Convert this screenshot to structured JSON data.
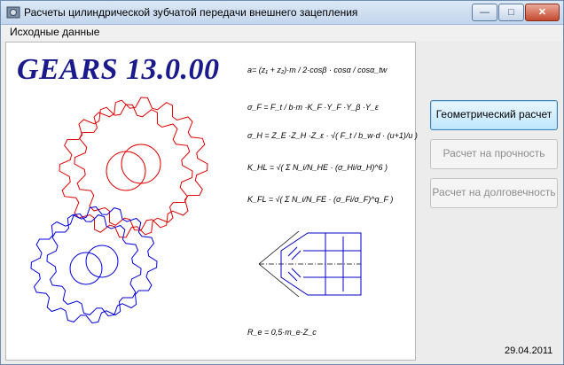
{
  "window": {
    "title": "Расчеты цилиндрической зубчатой передачи внешнего зацепления",
    "controls": {
      "minimize": "—",
      "maximize": "□",
      "close": "✕"
    }
  },
  "menu": {
    "items": [
      "Исходные данные"
    ]
  },
  "panel": {
    "logo": "GEARS 13.0.00",
    "formulas": {
      "aw_lhs": "a",
      "aw_eq": "= (z₁ + z₂)·m / 2·cosβ · cosα / cosα_tw",
      "sigmaF": "σ_F = F_t / b·m ·K_F ·Y_F ·Y_β ·Y_ε",
      "sigmaH": "σ_H = Z_E ·Z_H ·Z_ε · √( F_t / b_w·d · (u+1)/u )",
      "KHL": "K_HL = √( Σ N_i/N_HE · (σ_Hi/σ_H)^6 )",
      "KFL": "K_FL = √( Σ N_i/N_FE · (σ_Fi/σ_F)^q_F )",
      "Ra": "R_e = 0,5·m_e·Z_c"
    }
  },
  "buttons": {
    "geometric": "Геометрический расчет",
    "strength": "Расчет на прочность",
    "durability": "Расчет на долговечность"
  },
  "status": {
    "date": "29.04.2011"
  },
  "colors": {
    "gear_top": "#e00000",
    "gear_bottom": "#0000e0",
    "logo": "#1a1a8c"
  }
}
